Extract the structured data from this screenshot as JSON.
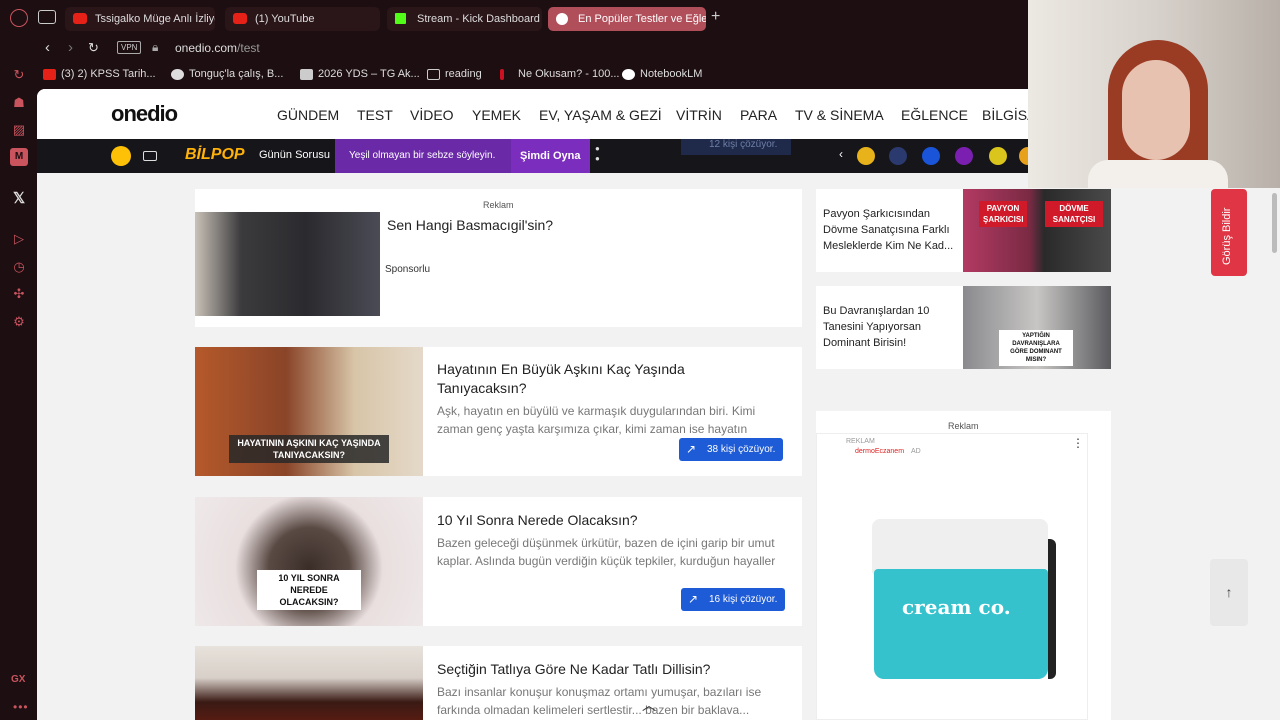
{
  "browser": {
    "tabs": [
      {
        "label": "Tssigalko Müge Anlı İzliyor",
        "icon": "youtube-icon"
      },
      {
        "label": "(1) YouTube",
        "icon": "youtube-icon"
      },
      {
        "label": "Stream - Kick Dashboard",
        "icon": "kick-icon"
      },
      {
        "label": "En Popüler Testler ve Eğlen",
        "icon": "onedio-icon",
        "active": true
      }
    ],
    "address": {
      "vpn": "VPN",
      "domain": "onedio.com",
      "path": "/test"
    },
    "bookmarks": [
      {
        "label": "(3) 2) KPSS Tarih..."
      },
      {
        "label": "Tonguç'la çalış, B..."
      },
      {
        "label": "2026 YDS – TG Ak..."
      },
      {
        "label": "reading"
      },
      {
        "label": "Ne Okusam? - 100..."
      },
      {
        "label": "NotebookLM"
      }
    ],
    "sidebar_bottom": "GX"
  },
  "site": {
    "logo": "onedio",
    "menu": [
      "GÜNDEM",
      "TEST",
      "VİDEO",
      "YEMEK",
      "EV, YAŞAM & GEZİ",
      "VİTRİN",
      "PARA",
      "TV & SİNEMA",
      "EĞLENCE",
      "BİLGİSA"
    ],
    "subbar": {
      "bilpop": "BİLPOP",
      "gunun": "Günün Sorusu",
      "question": "Yeşil olmayan bir sebze söyleyin.",
      "play": "Şimdi Oyna"
    },
    "sponsored": {
      "reklam": "Reklam",
      "title": "Sen Hangi Basmacıgil'sin?",
      "sponsor": "Sponsorlu"
    },
    "tests": [
      {
        "title": "Hayatının En Büyük Aşkını Kaç Yaşında Tanıyacaksın?",
        "desc": "Aşk, hayatın en büyülü ve karmaşık duygularından biri. Kimi zaman genç yaşta karşımıza çıkar, kimi zaman ise hayatın ilerleyen...",
        "overlay": "HAYATININ AŞKINI KAÇ YAŞINDA TANIYACAKSIN?",
        "badge": "38 kişi çözüyor."
      },
      {
        "title": "10 Yıl Sonra Nerede Olacaksın?",
        "desc": "Bazen geleceği düşünmek ürkütür, bazen de içini garip bir umut kaplar. Aslında bugün verdiğin küçük tepkiler, kurduğun hayaller v...",
        "overlay": "10 YIL SONRA NEREDE OLACAKSIN?",
        "badge": "16 kişi çözüyor."
      },
      {
        "title": "Seçtiğin Tatlıya Göre Ne Kadar Tatlı Dillisin?",
        "desc": "Bazı insanlar konuşur konuşmaz ortamı yumuşar, bazıları ise farkında olmadan kelimeleri sertlestir... bazen bir baklava..."
      }
    ],
    "side": [
      {
        "title": "Pavyon Şarkıcısından Dövme Sanatçısına Farklı Mesleklerde Kim Ne Kad...",
        "tag1": "PAVYON ŞARKICISI",
        "tag2": "DÖVME SANATÇISI"
      },
      {
        "title": "Bu Davranışlardan 10 Tanesini Yapıyorsan Dominant Birisin!",
        "tag1": "YAPTIĞIN DAVRANIŞLARA GÖRE DOMINANT MISIN?"
      }
    ],
    "ad": {
      "reklam": "Reklam",
      "small": "REKLAM",
      "advertiser": "dermoEczanem",
      "ad_tag": "AD",
      "product": "cream co."
    },
    "feedback": "Görüş Bildir",
    "ticker_ghost": "12 kişi çözüyor."
  },
  "colors": {
    "accent": "#b04e5a",
    "badge": "#1e5bd6",
    "feedback": "#e03545",
    "bilpop": "#ffb20a"
  }
}
